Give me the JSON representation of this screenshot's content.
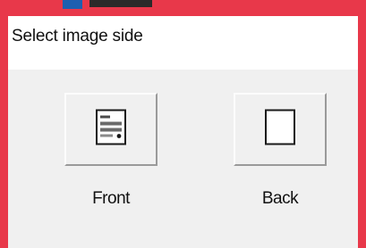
{
  "dialog": {
    "title": "Select image side"
  },
  "options": [
    {
      "label": "Front",
      "icon": "card-front-icon"
    },
    {
      "label": "Back",
      "icon": "card-back-icon"
    }
  ],
  "colors": {
    "highlight_border": "#e8384a",
    "face": "#f0f0f0",
    "title_background": "#ffffff"
  }
}
